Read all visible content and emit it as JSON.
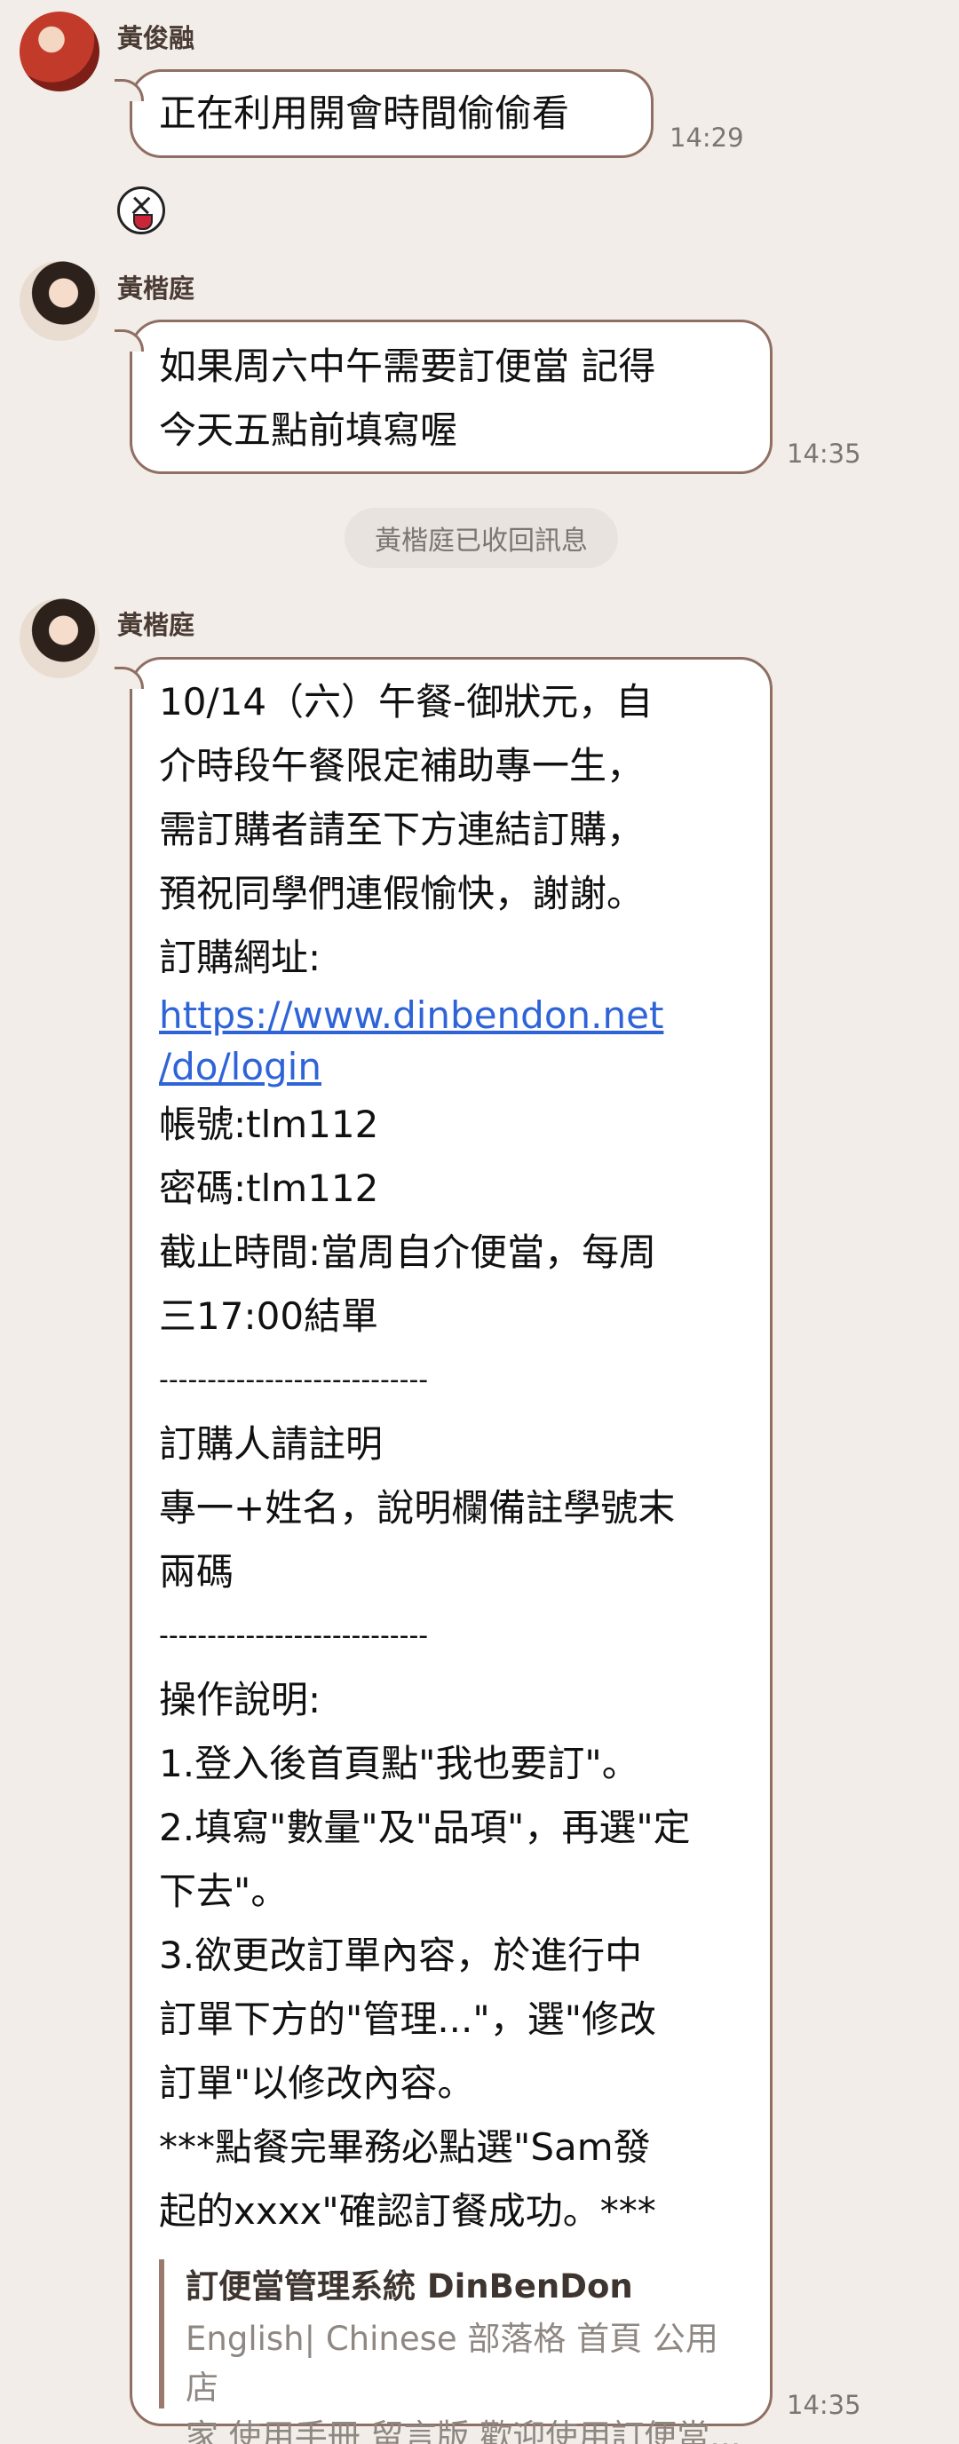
{
  "messages": [
    {
      "sender": "黃俊融",
      "text": "正在利用開會時間偷偷看",
      "time": "14:29",
      "emoji": "grinning-squint-emoji"
    },
    {
      "sender": "黃楷庭",
      "lines": [
        "如果周六中午需要訂便當 記得",
        "今天五點前填寫喔"
      ],
      "time": "14:35"
    },
    {
      "system": "黃楷庭已收回訊息"
    },
    {
      "sender": "黃楷庭",
      "time": "14:35",
      "body": [
        "10/14（六）午餐-御狀元，自",
        "介時段午餐限定補助專一生，",
        "需訂購者請至下方連結訂購，",
        "預祝同學們連假愉快，謝謝。",
        "訂購網址:"
      ],
      "link_lines": [
        "https://www.dinbendon.net",
        "/do/login"
      ],
      "body2": [
        "帳號:tlm112",
        "密碼:tlm112",
        "截止時間:當周自介便當，每周",
        "三17:00結單",
        "----------------------------",
        "訂購人請註明",
        "專一+姓名，說明欄備註學號末",
        "兩碼",
        "----------------------------",
        "操作說明:",
        "1.登入後首頁點\"我也要訂\"。",
        "2.填寫\"數量\"及\"品項\"，再選\"定",
        "下去\"。",
        "3.欲更改訂單內容，於進行中",
        "訂單下方的\"管理...\"，選\"修改",
        "訂單\"以修改內容。",
        "***點餐完畢務必點選\"Sam發",
        "起的xxxx\"確認訂餐成功。***"
      ],
      "preview": {
        "title": "訂便當管理系統 DinBenDon",
        "desc_lines": [
          "English| Chinese 部落格 首頁 公用店",
          "家 使用手冊 留言版 歡迎使用訂便當..."
        ]
      }
    }
  ]
}
